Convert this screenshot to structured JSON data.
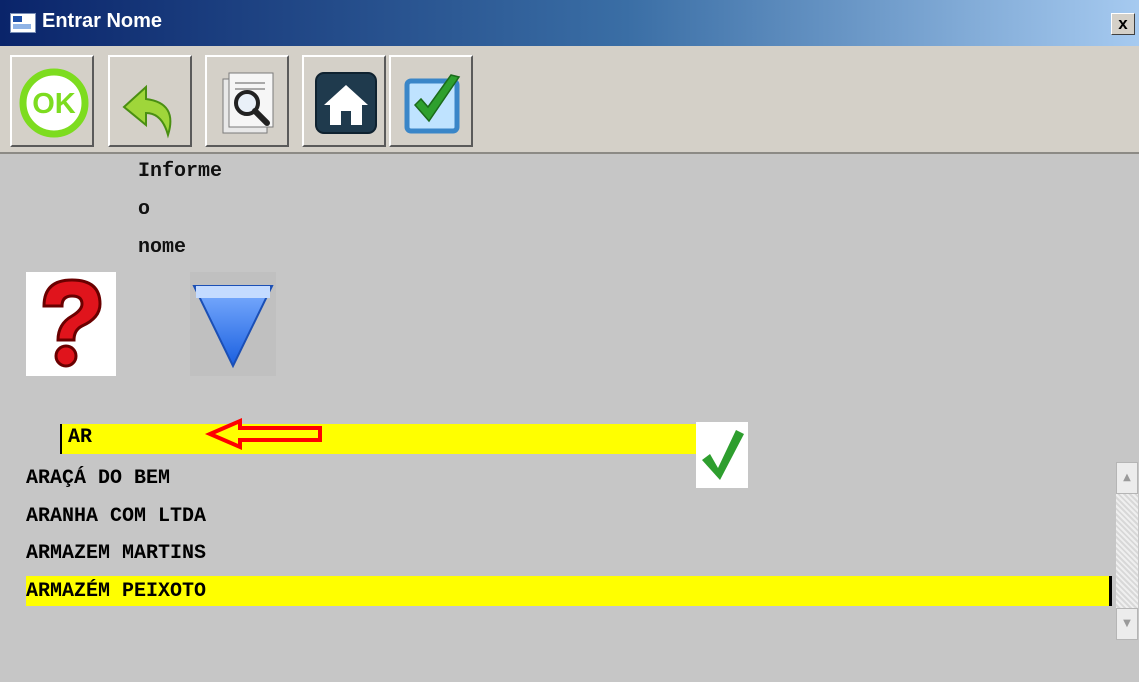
{
  "window": {
    "title": "Entrar Nome",
    "close_label": "x"
  },
  "toolbar": {
    "buttons": [
      {
        "icon": "ok-icon",
        "label": "OK"
      },
      {
        "icon": "back-arrow-icon"
      },
      {
        "icon": "search-document-icon"
      },
      {
        "icon": "home-icon"
      },
      {
        "icon": "checkbox-check-icon"
      }
    ]
  },
  "prompt": {
    "line1": "Informe",
    "line2": "o",
    "line3": "nome"
  },
  "icons": {
    "help": "question-mark-icon",
    "dropdown": "dropdown-triangle-icon",
    "confirm": "green-check-icon",
    "annotation": "red-arrow-icon"
  },
  "input": {
    "value": "AR"
  },
  "list": {
    "items": [
      "ARAÇÁ DO BEM",
      "ARANHA COM LTDA",
      "ARMAZEM MARTINS",
      "ARMAZÉM PEIXOTO"
    ],
    "selected_index": 3
  },
  "colors": {
    "highlight": "#ffff00",
    "background": "#c6c6c6",
    "toolbar": "#d4d0c8",
    "annotation": "#ff0000",
    "check": "#2e9e2e"
  }
}
